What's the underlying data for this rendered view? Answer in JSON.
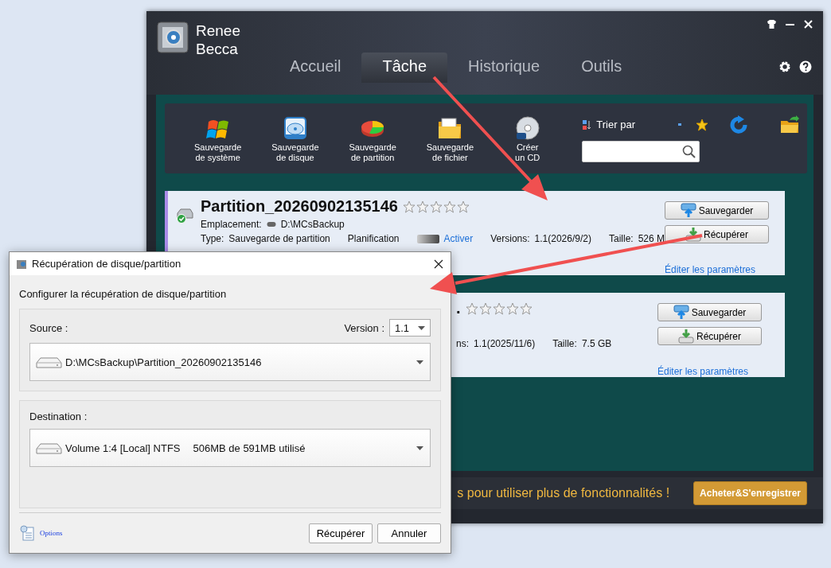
{
  "app": {
    "title": "Renee\nBecca",
    "tabs": [
      {
        "label": "Accueil",
        "selected": false
      },
      {
        "label": "Tâche",
        "selected": true
      },
      {
        "label": "Historique",
        "selected": false
      },
      {
        "label": "Outils",
        "selected": false
      }
    ],
    "toolbar": {
      "tools": [
        {
          "kind": "system",
          "label": "Sauvegarde\nde système"
        },
        {
          "kind": "disk",
          "label": "Sauvegarde\nde disque"
        },
        {
          "kind": "partition",
          "label": "Sauvegarde\nde partition"
        },
        {
          "kind": "file",
          "label": "Sauvegarde\nde fichier"
        },
        {
          "kind": "cd",
          "label": "Créer\nun CD"
        }
      ],
      "sort_label": "Trier par"
    },
    "tasks": [
      {
        "title": "Partition_20260902135146",
        "stars": 0,
        "location_label": "Emplacement:",
        "location": "D:\\MCsBackup",
        "type_label": "Type:",
        "type": "Sauvegarde de partition",
        "schedule_label": "Planification",
        "schedule_on": false,
        "schedule_link": "Activer",
        "versions_label": "Versions:",
        "versions": "1.1(2026/9/2)",
        "size_label": "Taille:",
        "size": "526 M",
        "buttons": [
          "Sauvegarder",
          "Récupérer"
        ],
        "edit_link": "Éditer les paramètres"
      },
      {
        "title": ".",
        "stars": 0,
        "versions_label": "ns:",
        "versions": "1.1(2025/11/6)",
        "size_label": "Taille:",
        "size": "7.5 GB",
        "buttons": [
          "Sauvegarder",
          "Récupérer"
        ],
        "edit_link": "Éditer les paramètres"
      }
    ],
    "footer": {
      "message": "s pour utiliser plus de fonctionnalités !",
      "button": "Acheter&S'enregistrer"
    }
  },
  "dialog": {
    "title": "Récupération de disque/partition",
    "heading": "Configurer la récupération de disque/partition",
    "source": {
      "label": "Source :",
      "version_label": "Version :",
      "version": "1.1",
      "path": "D:\\MCsBackup\\Partition_20260902135146"
    },
    "destination": {
      "label": "Destination :",
      "volume": "Volume 1:4 [Local] NTFS",
      "usage": "506MB de 591MB utilisé"
    },
    "options_link": "Options",
    "buttons": [
      "Récupérer",
      "Annuler"
    ]
  }
}
